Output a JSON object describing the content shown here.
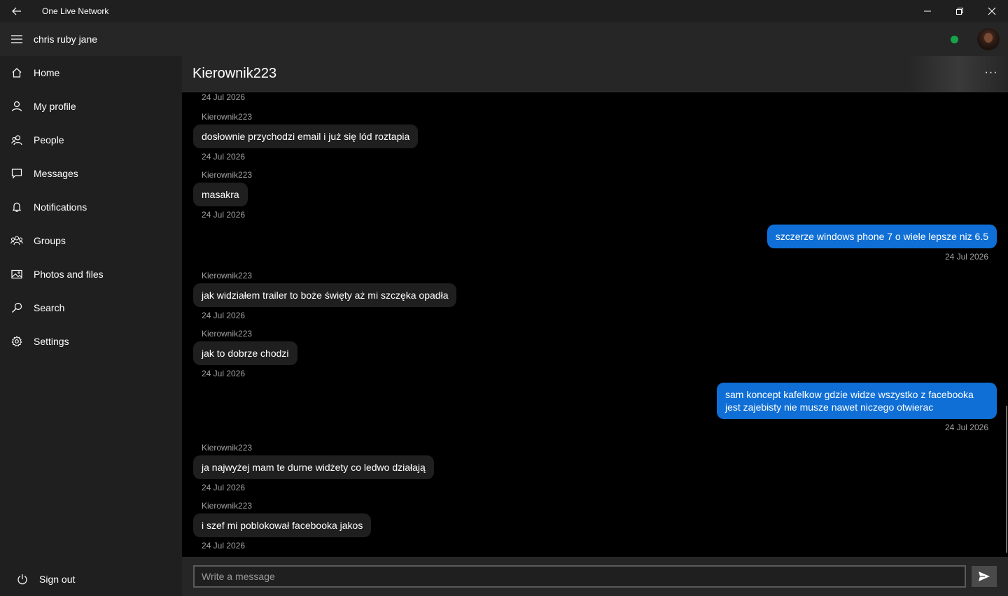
{
  "window": {
    "title": "One Live Network"
  },
  "header": {
    "user_name": "chris ruby jane",
    "status_color": "#16a34a"
  },
  "sidebar": {
    "items": [
      {
        "label": "Home",
        "icon": "home-icon"
      },
      {
        "label": "My profile",
        "icon": "person-icon"
      },
      {
        "label": "People",
        "icon": "people-icon"
      },
      {
        "label": "Messages",
        "icon": "message-icon"
      },
      {
        "label": "Notifications",
        "icon": "bell-icon"
      },
      {
        "label": "Groups",
        "icon": "groups-icon"
      },
      {
        "label": "Photos and files",
        "icon": "photo-icon"
      },
      {
        "label": "Search",
        "icon": "search-icon"
      },
      {
        "label": "Settings",
        "icon": "gear-icon"
      }
    ],
    "signout_label": "Sign out"
  },
  "conversation": {
    "title": "Kierownik223",
    "more_label": "···",
    "top_timestamp": "24 Jul 2026",
    "messages": [
      {
        "direction": "in",
        "sender": "Kierownik223",
        "text": "dosłownie przychodzi email i już się lód roztapia",
        "time": "24 Jul 2026"
      },
      {
        "direction": "in",
        "sender": "Kierownik223",
        "text": "masakra",
        "time": "24 Jul 2026"
      },
      {
        "direction": "out",
        "sender": "",
        "text": "szczerze windows phone 7 o wiele lepsze niz 6.5",
        "time": "24 Jul 2026"
      },
      {
        "direction": "in",
        "sender": "Kierownik223",
        "text": "jak widziałem trailer to boże święty aż mi szczęka opadła",
        "time": "24 Jul 2026"
      },
      {
        "direction": "in",
        "sender": "Kierownik223",
        "text": "jak to dobrze chodzi",
        "time": "24 Jul 2026"
      },
      {
        "direction": "out",
        "sender": "",
        "text": "sam koncept kafelkow gdzie widze wszystko z facebooka jest zajebisty nie musze nawet niczego otwierac",
        "time": "24 Jul 2026"
      },
      {
        "direction": "in",
        "sender": "Kierownik223",
        "text": "ja najwyżej mam te durne widżety co ledwo działają",
        "time": "24 Jul 2026"
      },
      {
        "direction": "in",
        "sender": "Kierownik223",
        "text": "i szef mi poblokował facebooka jakos",
        "time": "24 Jul 2026"
      }
    ]
  },
  "composer": {
    "placeholder": "Write a message",
    "value": ""
  },
  "colors": {
    "accent": "#0f6fd6",
    "incoming_bubble": "#1f1f1f",
    "sidebar_bg": "#1f1f1f"
  }
}
